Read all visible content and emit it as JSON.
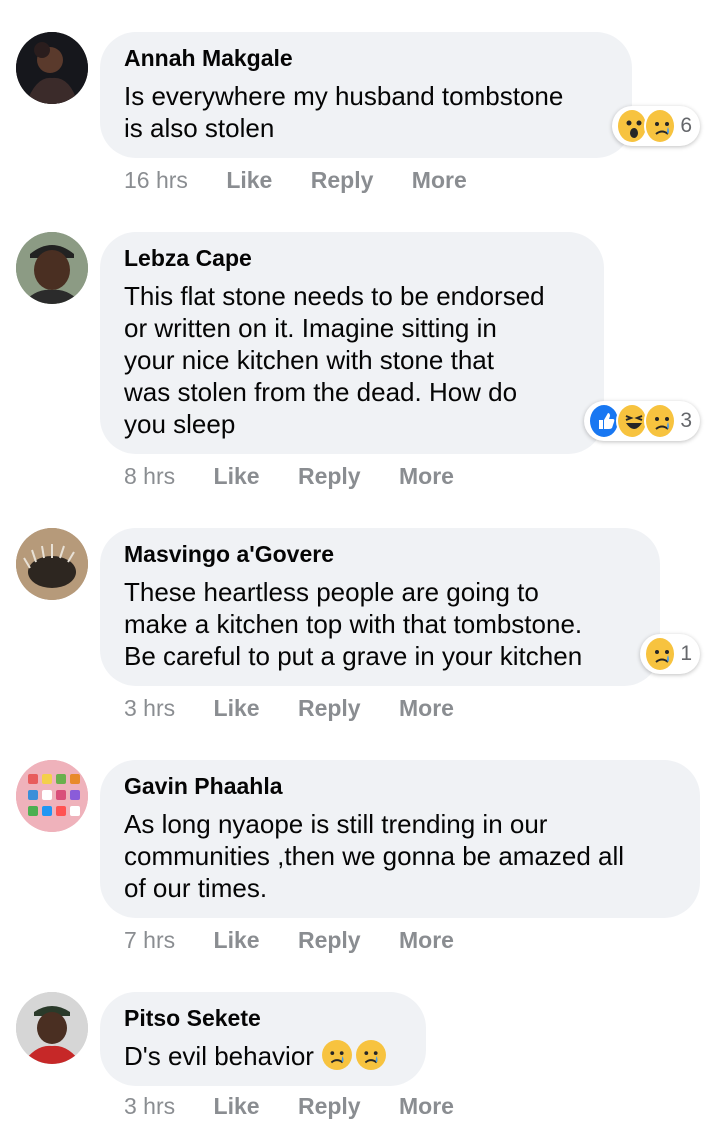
{
  "actions": {
    "like": "Like",
    "reply": "Reply",
    "more": "More"
  },
  "comments": [
    {
      "author": "Annah Makgale",
      "text": "Is everywhere my husband tombstone\nis also stolen",
      "time": "16 hrs",
      "reactions": {
        "icons": [
          "wow-icon",
          "sad-icon"
        ],
        "count": "6"
      }
    },
    {
      "author": "Lebza Cape",
      "text": "This flat stone needs to be endorsed\nor written on it. Imagine sitting in\nyour nice kitchen with stone that\nwas stolen from the dead. How do\nyou sleep",
      "time": "8 hrs",
      "reactions": {
        "icons": [
          "like-icon",
          "haha-icon",
          "sad-icon"
        ],
        "count": "3"
      }
    },
    {
      "author": "Masvingo a'Govere",
      "text": "These heartless people are going to\nmake a kitchen top with that tombstone.\nBe careful to put a grave in your kitchen",
      "time": "3 hrs",
      "reactions": {
        "icons": [
          "sad-icon"
        ],
        "count": "1"
      }
    },
    {
      "author": "Gavin Phaahla",
      "text": "As long nyaope is still trending in our\ncommunities ,then we gonna be amazed all\nof our times.",
      "time": "7 hrs",
      "reactions": null
    },
    {
      "author": "Pitso Sekete",
      "text": "D's evil behavior",
      "time": "3 hrs",
      "text_emojis": [
        "sad-icon",
        "sad-icon"
      ],
      "reactions": null
    }
  ],
  "colors": {
    "bubble": "#f0f2f5",
    "meta": "#8a8d91",
    "like_blue": "#1877f2",
    "emoji_yellow": "#f7c33f"
  }
}
